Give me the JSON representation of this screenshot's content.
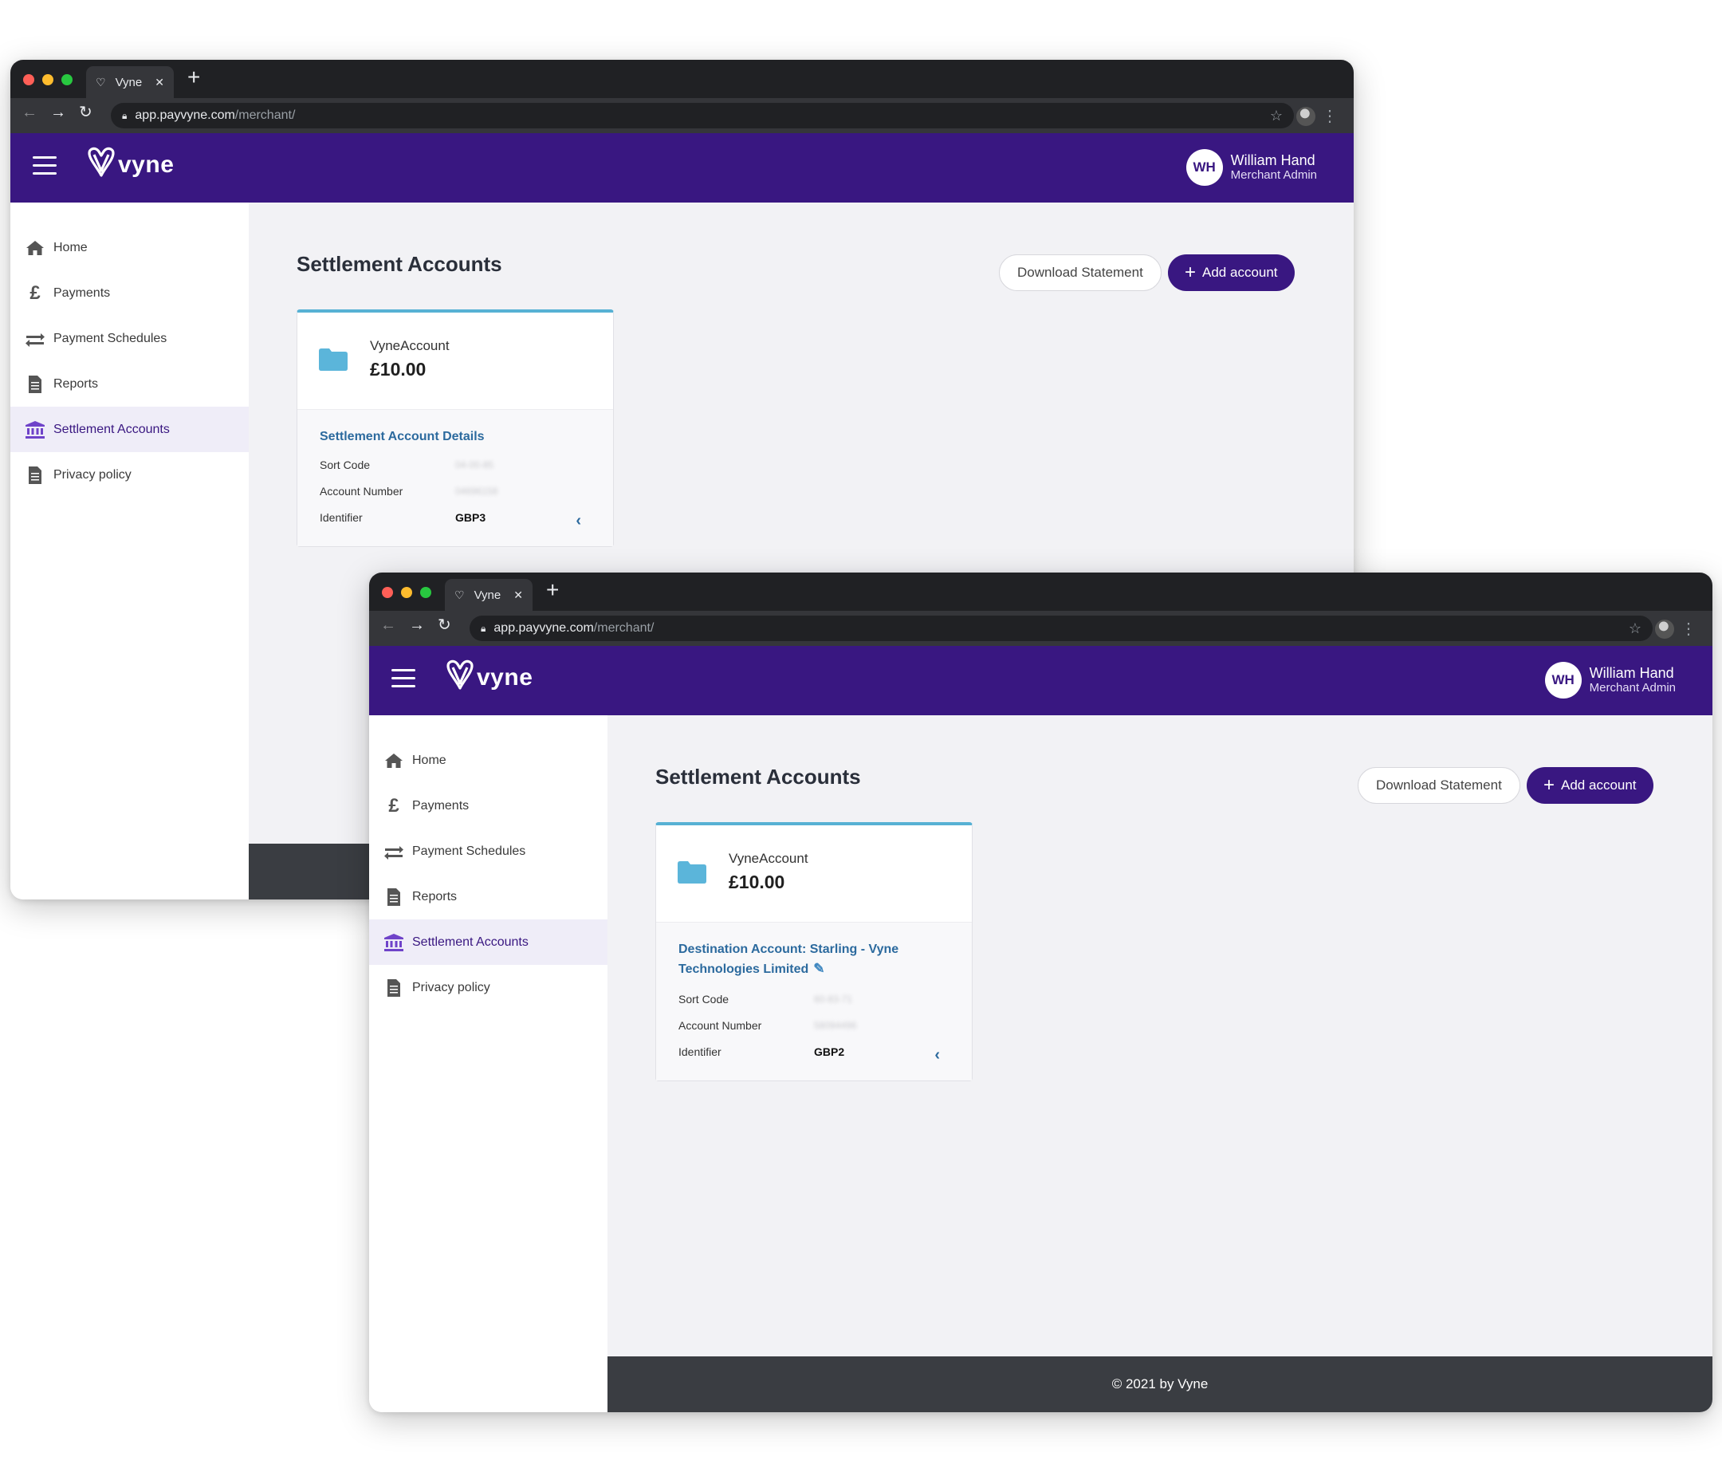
{
  "browser": {
    "tab_title": "Vyne",
    "url_host": "app.payvyne.com",
    "url_path": "/merchant/"
  },
  "header": {
    "logo_text": "vyne",
    "user_initials": "WH",
    "user_name": "William Hand",
    "user_role": "Merchant Admin"
  },
  "sidebar": {
    "items": [
      {
        "label": "Home",
        "icon": "home-icon"
      },
      {
        "label": "Payments",
        "icon": "pound-icon"
      },
      {
        "label": "Payment Schedules",
        "icon": "swap-arrows-icon"
      },
      {
        "label": "Reports",
        "icon": "document-icon"
      },
      {
        "label": "Settlement Accounts",
        "icon": "bank-icon",
        "active": true
      },
      {
        "label": "Privacy policy",
        "icon": "document-icon"
      }
    ]
  },
  "page": {
    "title": "Settlement Accounts",
    "download_label": "Download Statement",
    "add_label": "Add account"
  },
  "window1_card": {
    "account_name": "VyneAccount",
    "balance": "£10.00",
    "details_title": "Settlement Account Details",
    "sort_code_label": "Sort Code",
    "sort_code_value": "04-00-85",
    "account_number_label": "Account Number",
    "account_number_value": "04696158",
    "identifier_label": "Identifier",
    "identifier_value": "GBP3"
  },
  "window2_card": {
    "account_name": "VyneAccount",
    "balance": "£10.00",
    "details_title_line1": "Destination Account: Starling - Vyne",
    "details_title_line2": "Technologies Limited",
    "sort_code_label": "Sort Code",
    "sort_code_value": "60-83-71",
    "account_number_label": "Account Number",
    "account_number_value": "58094496",
    "identifier_label": "Identifier",
    "identifier_value": "GBP2"
  },
  "footer": {
    "text": "© 2021 by Vyne"
  },
  "colors": {
    "brand_purple": "#391781",
    "accent_blue": "#57b1d4",
    "footer_dark": "#3a3d42"
  }
}
